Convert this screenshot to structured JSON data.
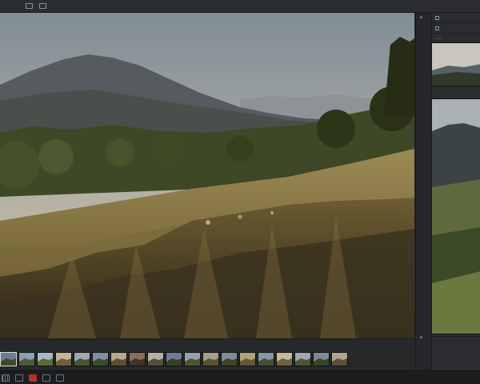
{
  "window": {
    "title": ""
  },
  "topbar": {
    "menu": [
      "",
      "",
      ""
    ],
    "tools": [
      {
        "icon": "crop-icon",
        "label": ""
      },
      {
        "icon": "rotate-icon",
        "label": ""
      }
    ]
  },
  "right_panel": {
    "rows": [
      {
        "icon": "folder-icon",
        "label": ""
      },
      {
        "icon": "image-icon",
        "label": ""
      }
    ],
    "tabs": [
      {
        "label": "",
        "active": true
      },
      {
        "label": "",
        "active": false
      }
    ],
    "footer": ""
  },
  "filmstrip": {
    "label": "",
    "thumbs": 19,
    "selected_index": 0
  },
  "status_bar": {
    "buttons": [
      "grid-view-icon",
      "compare-icon",
      "flag-icon",
      "stack-icon",
      "lock-icon"
    ]
  },
  "colors": {
    "accent": "#b2322d",
    "panel": "#2a2c2f",
    "background": "#222426"
  }
}
